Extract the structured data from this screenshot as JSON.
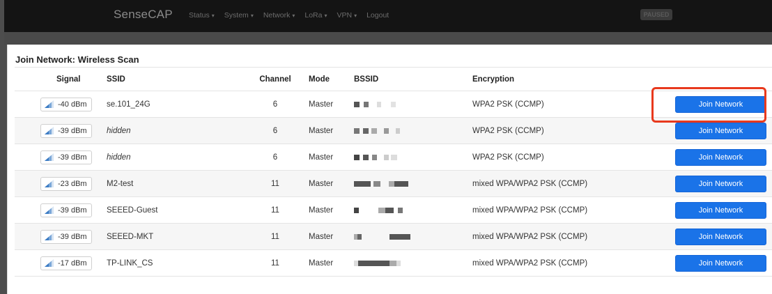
{
  "nav": {
    "brand": "SenseCAP",
    "menu": [
      {
        "label": "Status",
        "has_caret": true
      },
      {
        "label": "System",
        "has_caret": true
      },
      {
        "label": "Network",
        "has_caret": true
      },
      {
        "label": "LoRa",
        "has_caret": true
      },
      {
        "label": "VPN",
        "has_caret": true
      },
      {
        "label": "Logout",
        "has_caret": false
      }
    ],
    "status_badge": "PAUSED"
  },
  "page": {
    "title": "Join Network: Wireless Scan",
    "headers": {
      "signal": "Signal",
      "ssid": "SSID",
      "channel": "Channel",
      "mode": "Mode",
      "bssid": "BSSID",
      "encryption": "Encryption"
    },
    "join_label": "Join Network",
    "rows": [
      {
        "signal": "-40 dBm",
        "ssid": "se.101_24G",
        "ssid_italic": false,
        "channel": "6",
        "mode": "Master",
        "encryption": "WPA2 PSK (CCMP)"
      },
      {
        "signal": "-39 dBm",
        "ssid": "hidden",
        "ssid_italic": true,
        "channel": "6",
        "mode": "Master",
        "encryption": "WPA2 PSK (CCMP)"
      },
      {
        "signal": "-39 dBm",
        "ssid": "hidden",
        "ssid_italic": true,
        "channel": "6",
        "mode": "Master",
        "encryption": "WPA2 PSK (CCMP)"
      },
      {
        "signal": "-23 dBm",
        "ssid": "M2-test",
        "ssid_italic": false,
        "channel": "11",
        "mode": "Master",
        "encryption": "mixed WPA/WPA2 PSK (CCMP)"
      },
      {
        "signal": "-39 dBm",
        "ssid": "SEEED-Guest",
        "ssid_italic": false,
        "channel": "11",
        "mode": "Master",
        "encryption": "mixed WPA/WPA2 PSK (CCMP)"
      },
      {
        "signal": "-39 dBm",
        "ssid": "SEEED-MKT",
        "ssid_italic": false,
        "channel": "11",
        "mode": "Master",
        "encryption": "mixed WPA/WPA2 PSK (CCMP)"
      },
      {
        "signal": "-17 dBm",
        "ssid": "TP-LINK_CS",
        "ssid_italic": false,
        "channel": "11",
        "mode": "Master",
        "encryption": "mixed WPA/WPA2 PSK (CCMP)"
      }
    ]
  },
  "colors": {
    "topbar": "#141414",
    "button": "#1a73e8",
    "highlight": "#e8391d"
  },
  "icons": {
    "signal": "signal-strength-icon"
  }
}
